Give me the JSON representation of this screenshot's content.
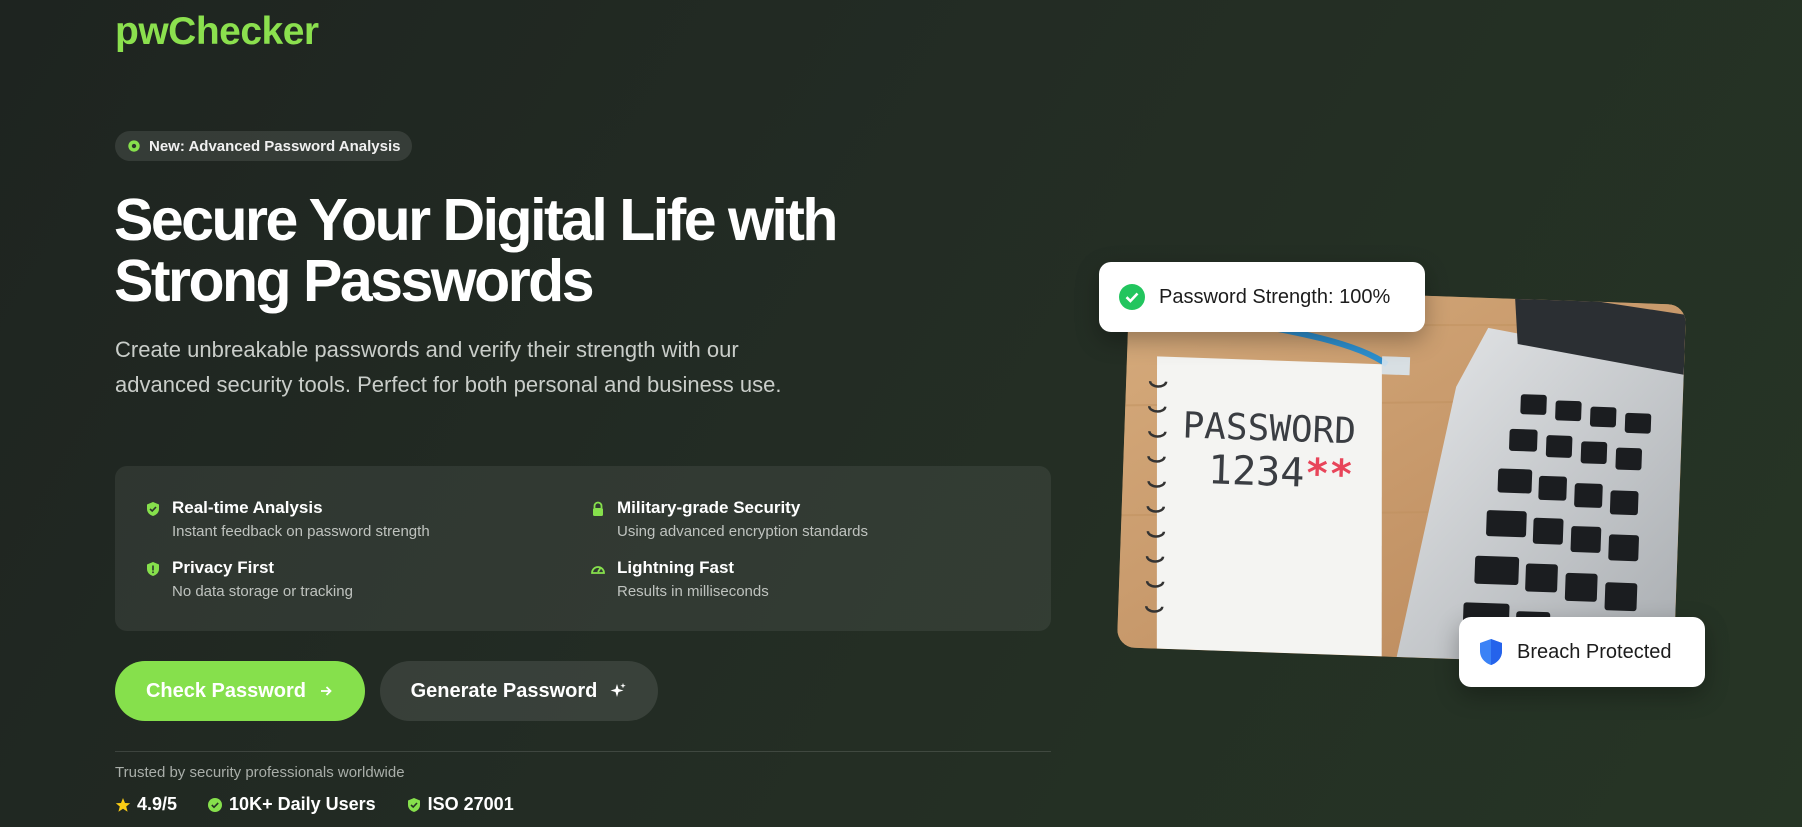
{
  "brand": {
    "name": "pwChecker",
    "accent": "#86e04c"
  },
  "badge": {
    "icon": "gear-badge-icon",
    "label": "New: Advanced Password Analysis"
  },
  "hero": {
    "title": "Secure Your Digital Life with Strong Passwords",
    "subtitle": "Create unbreakable passwords and verify their strength with our advanced security tools. Perfect for both personal and business use."
  },
  "features": [
    {
      "icon": "shield-check-icon",
      "title": "Real-time Analysis",
      "desc": "Instant feedback on password strength"
    },
    {
      "icon": "lock-icon",
      "title": "Military-grade Security",
      "desc": "Using advanced encryption standards"
    },
    {
      "icon": "shield-icon",
      "title": "Privacy First",
      "desc": "No data storage or tracking"
    },
    {
      "icon": "speedometer-icon",
      "title": "Lightning Fast",
      "desc": "Results in milliseconds"
    }
  ],
  "buttons": {
    "check_label": "Check Password",
    "generate_label": "Generate Password"
  },
  "trust": {
    "label": "Trusted by security professionals worldwide",
    "stats": [
      {
        "icon": "star-icon",
        "label": "4.9/5"
      },
      {
        "icon": "verified-badge-icon",
        "label": "10K+ Daily Users"
      },
      {
        "icon": "shield-check-icon",
        "label": "ISO 27001"
      }
    ]
  },
  "image": {
    "notebook_text_line1": "PASSWORD",
    "notebook_text_line2": "1234",
    "notebook_text_marks": "**"
  },
  "cards": {
    "strength": "Password Strength: 100%",
    "breach": "Breach Protected"
  },
  "colors": {
    "check_green": "#22c55e",
    "shield_blue": "#3b82f6"
  }
}
